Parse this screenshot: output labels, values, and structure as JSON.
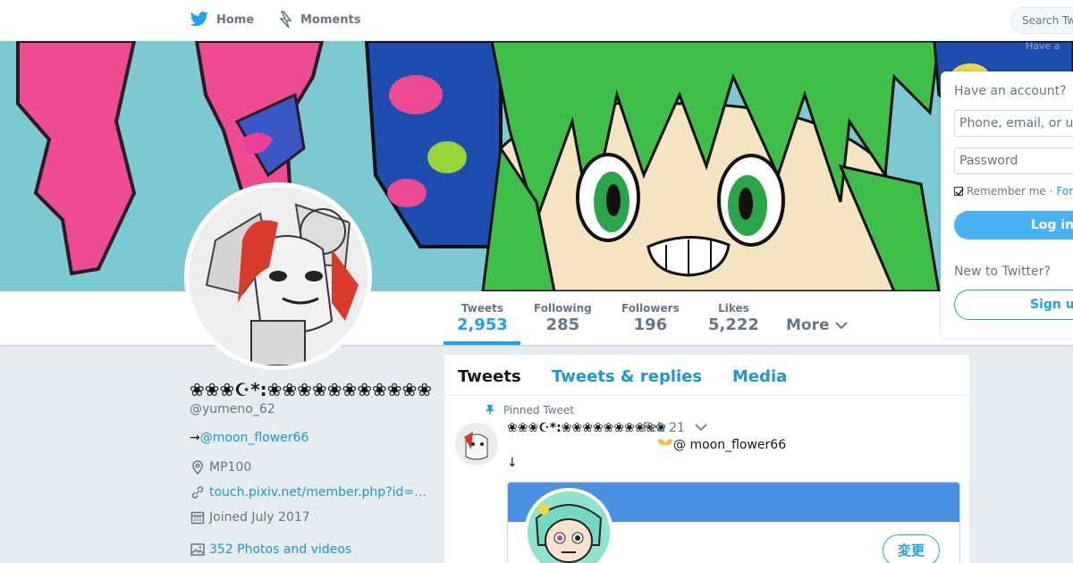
{
  "topbar": {
    "home_label": "Home",
    "moments_label": "Moments",
    "search_placeholder": "Search Tw"
  },
  "profile": {
    "display_name": "❀❀❀☪*:❀❀❀❀❀❀❀❀❀❀❀",
    "handle": "@yumeno_62",
    "bio_prefix": "→",
    "bio_link": "@moon_flower66",
    "location": "MP100",
    "website": "touch.pixiv.net/member.php?id=…",
    "joined": "Joined July 2017",
    "photos": "352 Photos and videos"
  },
  "stats": [
    {
      "label": "Tweets",
      "value": "2,953"
    },
    {
      "label": "Following",
      "value": "285"
    },
    {
      "label": "Followers",
      "value": "196"
    },
    {
      "label": "Likes",
      "value": "5,222"
    }
  ],
  "more_label": "More",
  "timeline": {
    "tabs": [
      "Tweets",
      "Tweets & replies",
      "Media"
    ],
    "pinned_label": "Pinned Tweet",
    "tweet": {
      "author": "❀❀❀☪*:❀❀❀❀❀❀❀❀❀❀",
      "date": "· Feb 21",
      "mention": "@ moon_flower66",
      "arrow": "↓"
    },
    "embed_button": "変更"
  },
  "login": {
    "hint": "Have a",
    "title": "Have an account?",
    "username_placeholder": "Phone, email, or u",
    "password_placeholder": "Password",
    "remember": "Remember me",
    "forgot": "· Forg",
    "login_button": "Log in",
    "new_label": "New to Twitter?",
    "signup_button": "Sign up"
  },
  "colors": {
    "accent": "#1da1f2",
    "link": "#1b95e0",
    "background": "#e6ecf0"
  }
}
